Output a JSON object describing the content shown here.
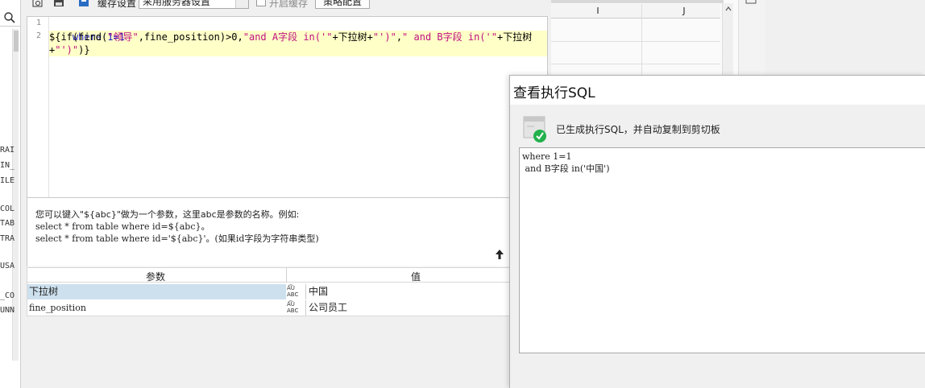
{
  "left_strip": {
    "truncated_labels": [
      "RAI",
      "IN_",
      "ILE",
      "COL",
      "TAB",
      "TRA",
      "USA",
      "_CO",
      "UNN"
    ]
  },
  "toolbar": {
    "cache_label": "缓存设置",
    "server_select": "采用服务器设置",
    "checkbox_label": "开启缓存",
    "strategy_button": "策略配置"
  },
  "editor": {
    "line_numbers": [
      "1",
      "2"
    ],
    "line1": "where 1=1",
    "line2_a": "${if(find(",
    "line2_b": "\"领导\"",
    "line2_c": ",fine_position)>0,",
    "line2_d": "\"and A字段 in('\"",
    "line2_e": "+下拉树+",
    "line2_f": "\"')\"",
    "line2_g": ",",
    "line2_h": "\" and B字段 in('\"",
    "line2_i": "+下拉树",
    "line3_a": "+",
    "line3_b": "\"')\"",
    "line3_c": ")}"
  },
  "hint": {
    "line1": "您可以键入\"${abc}\"做为一个参数，这里abc是参数的名称。例如:",
    "line2": "select * from table where id=${abc}。",
    "line3": "select * from table where id='${abc}'。(如果id字段为字符串类型)"
  },
  "params": {
    "header_name": "参数",
    "header_value": "值",
    "rows": [
      {
        "name": "下拉树",
        "type": "ABC",
        "value": "中国"
      },
      {
        "name": "fine_position",
        "type": "ABC",
        "value": "公司员工"
      }
    ]
  },
  "grid": {
    "columns": [
      "I",
      "J"
    ]
  },
  "dialog": {
    "title": "查看执行SQL",
    "message": "已生成执行SQL，并自动复制到剪切板",
    "sql": "where 1=1\n and B字段 in('中国')"
  },
  "colors": {
    "keyword": "#2020c8",
    "string": "#c01080",
    "highlight_line": "#ffffc8",
    "selected_row": "#cde0ee",
    "success_green": "#22b14c"
  },
  "icons": [
    "search-icon",
    "preview-icon",
    "save-icon",
    "cache-icon",
    "arrow-up-icon",
    "success-check-icon",
    "type-abc-icon",
    "scroll-up-icon"
  ]
}
